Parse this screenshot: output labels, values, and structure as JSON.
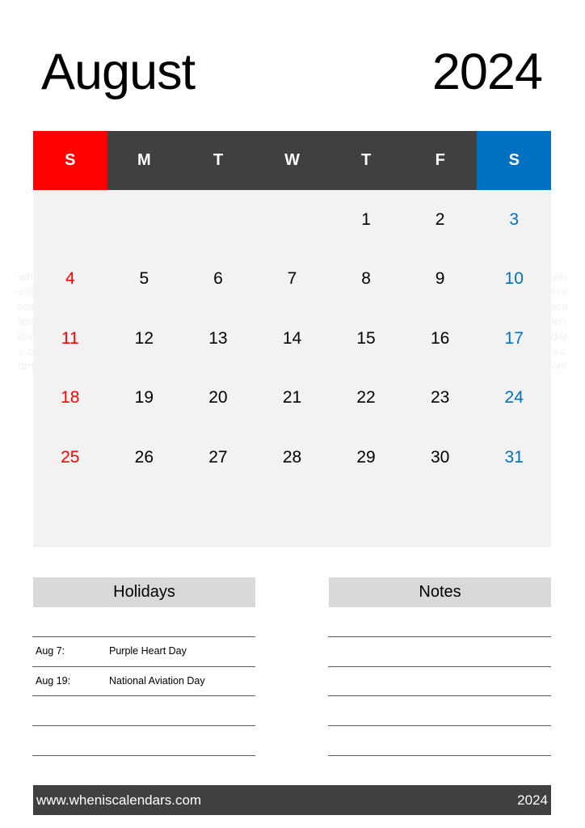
{
  "header": {
    "month": "August",
    "year": "2024"
  },
  "watermark": "wheniscalendars.com",
  "colors": {
    "sunday": "#ff0000",
    "saturday": "#0070c0",
    "weekday_bar": "#404040",
    "grid_bg": "#f2f2f2",
    "section_head_bg": "#d9d9d9"
  },
  "weekdays": [
    "S",
    "M",
    "T",
    "W",
    "T",
    "F",
    "S"
  ],
  "weeks": [
    [
      "",
      "",
      "",
      "",
      "1",
      "2",
      "3"
    ],
    [
      "4",
      "5",
      "6",
      "7",
      "8",
      "9",
      "10"
    ],
    [
      "11",
      "12",
      "13",
      "14",
      "15",
      "16",
      "17"
    ],
    [
      "18",
      "19",
      "20",
      "21",
      "22",
      "23",
      "24"
    ],
    [
      "25",
      "26",
      "27",
      "28",
      "29",
      "30",
      "31"
    ],
    [
      "",
      "",
      "",
      "",
      "",
      "",
      ""
    ]
  ],
  "holidays": {
    "title": "Holidays",
    "items": [
      {
        "date": "Aug 7:",
        "name": "Purple Heart Day"
      },
      {
        "date": "Aug 19:",
        "name": "National Aviation Day"
      }
    ]
  },
  "notes": {
    "title": "Notes"
  },
  "footer": {
    "site": "www.wheniscalendars.com",
    "year": "2024"
  }
}
